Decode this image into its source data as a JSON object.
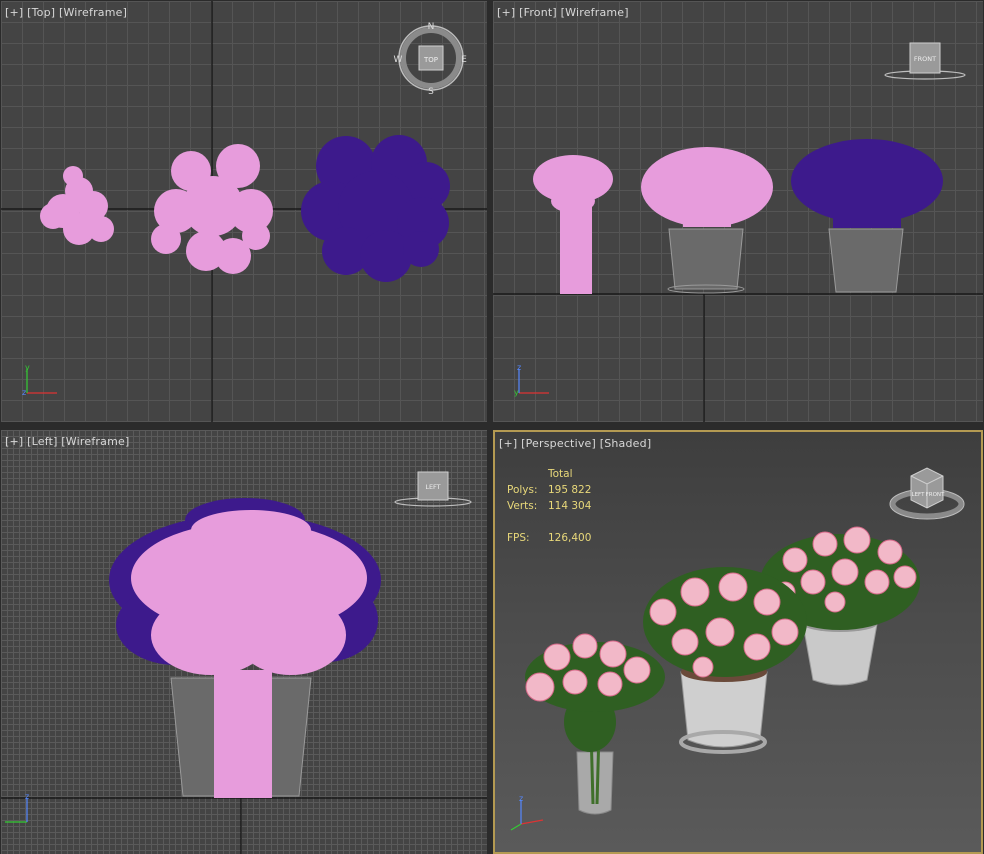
{
  "viewports": {
    "top": {
      "plus": "[+]",
      "name": "[Top]",
      "mode": "[Wireframe]"
    },
    "front": {
      "plus": "[+]",
      "name": "[Front]",
      "mode": "[Wireframe]"
    },
    "left": {
      "plus": "[+]",
      "name": "[Left]",
      "mode": "[Wireframe]"
    },
    "persp": {
      "plus": "[+]",
      "name": "[Perspective]",
      "mode": "[Shaded]"
    }
  },
  "stats": {
    "header": "Total",
    "polys_label": "Polys:",
    "polys_value": "195 822",
    "verts_label": "Verts:",
    "verts_value": "114 304",
    "fps_label": "FPS:",
    "fps_value": "126,400"
  },
  "compass": {
    "n": "N",
    "s": "S",
    "e": "E",
    "w": "W"
  },
  "viewcube": {
    "top": "TOP",
    "front": "FRONT",
    "left": "LEFT"
  },
  "axes": {
    "x": "x",
    "y": "y",
    "z": "z"
  },
  "colors": {
    "viewport_bg": "#444444",
    "active_border": "#b49a52",
    "pink_wire": "#e79cdc",
    "purple_wire": "#3d1a8c",
    "pot_wire": "#8a8a8a",
    "stats_text": "#e8d87a"
  }
}
